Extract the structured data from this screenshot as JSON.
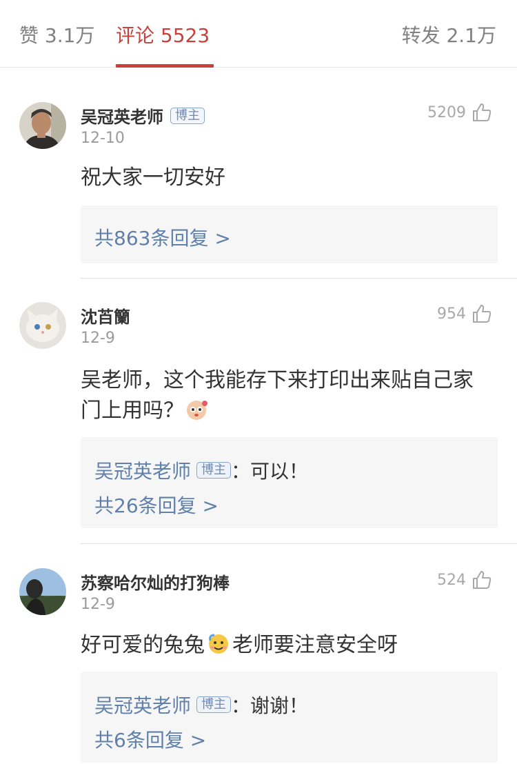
{
  "tabs": {
    "likes": "赞 3.1万",
    "comments": "评论 5523",
    "reposts": "转发 2.1万"
  },
  "accent_color": "#c9403b",
  "link_color": "#5f80ab",
  "comments": [
    {
      "author": "吴冠英老师",
      "badge": "博主",
      "date": "12-10",
      "likes": "5209",
      "text": "祝大家一切安好",
      "replies_link": "共863条回复 >"
    },
    {
      "author": "沈苩籣",
      "date": "12-9",
      "likes": "954",
      "text": "吴老师，这个我能存下来打印出来贴自己家门上用吗？",
      "emoji": "cute-face-emoji",
      "reply": {
        "author": "吴冠英老师",
        "badge": "博主",
        "text": "：可以！"
      },
      "replies_link": "共26条回复 >"
    },
    {
      "author": "苏察哈尔灿的打狗棒",
      "date": "12-9",
      "likes": "524",
      "text_before": "好可爱的兔兔",
      "emoji": "sweat-smile-emoji",
      "text_after": "老师要注意安全呀",
      "reply": {
        "author": "吴冠英老师",
        "badge": "博主",
        "text": "：谢谢！"
      },
      "replies_link": "共6条回复 >"
    }
  ]
}
